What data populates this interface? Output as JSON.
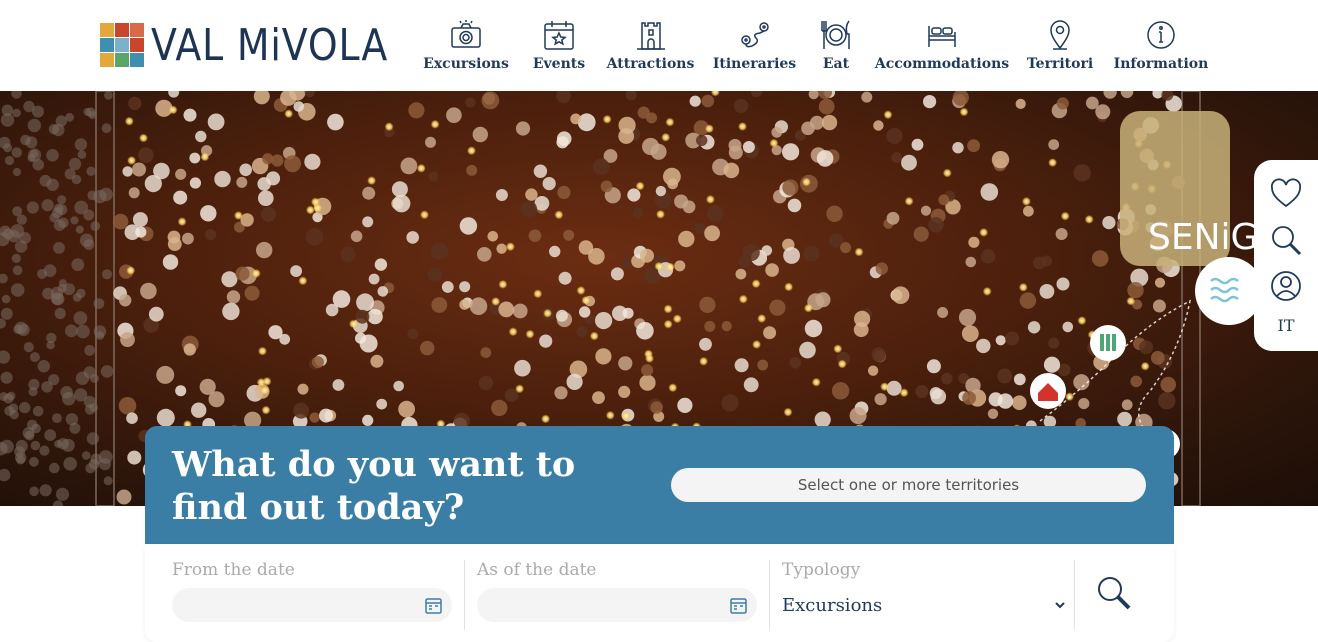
{
  "brand": {
    "name": "VAL MiVOLA"
  },
  "nav": {
    "items": [
      {
        "label": "Excursions",
        "icon": "camera-icon"
      },
      {
        "label": "Events",
        "icon": "calendar-star-icon"
      },
      {
        "label": "Attractions",
        "icon": "castle-icon"
      },
      {
        "label": "Itineraries",
        "icon": "route-icon"
      },
      {
        "label": "Eat",
        "icon": "plate-cutlery-icon"
      },
      {
        "label": "Accommodations",
        "icon": "bed-icon"
      },
      {
        "label": "Territori",
        "icon": "map-pin-icon"
      },
      {
        "label": "Information",
        "icon": "info-icon"
      }
    ]
  },
  "hero": {
    "overlay_text": "SENiGAL"
  },
  "side_tools": {
    "language": "IT"
  },
  "search": {
    "title": "What do you want to find out today?",
    "territory_placeholder": "Select one or more territories",
    "from_label": "From the date",
    "to_label": "As of the date",
    "typology_label": "Typology",
    "typology_value": "Excursions"
  },
  "colors": {
    "navy": "#1f3a5a",
    "panel_blue": "#3a7ea5",
    "input_bg": "#f4f4f4"
  }
}
